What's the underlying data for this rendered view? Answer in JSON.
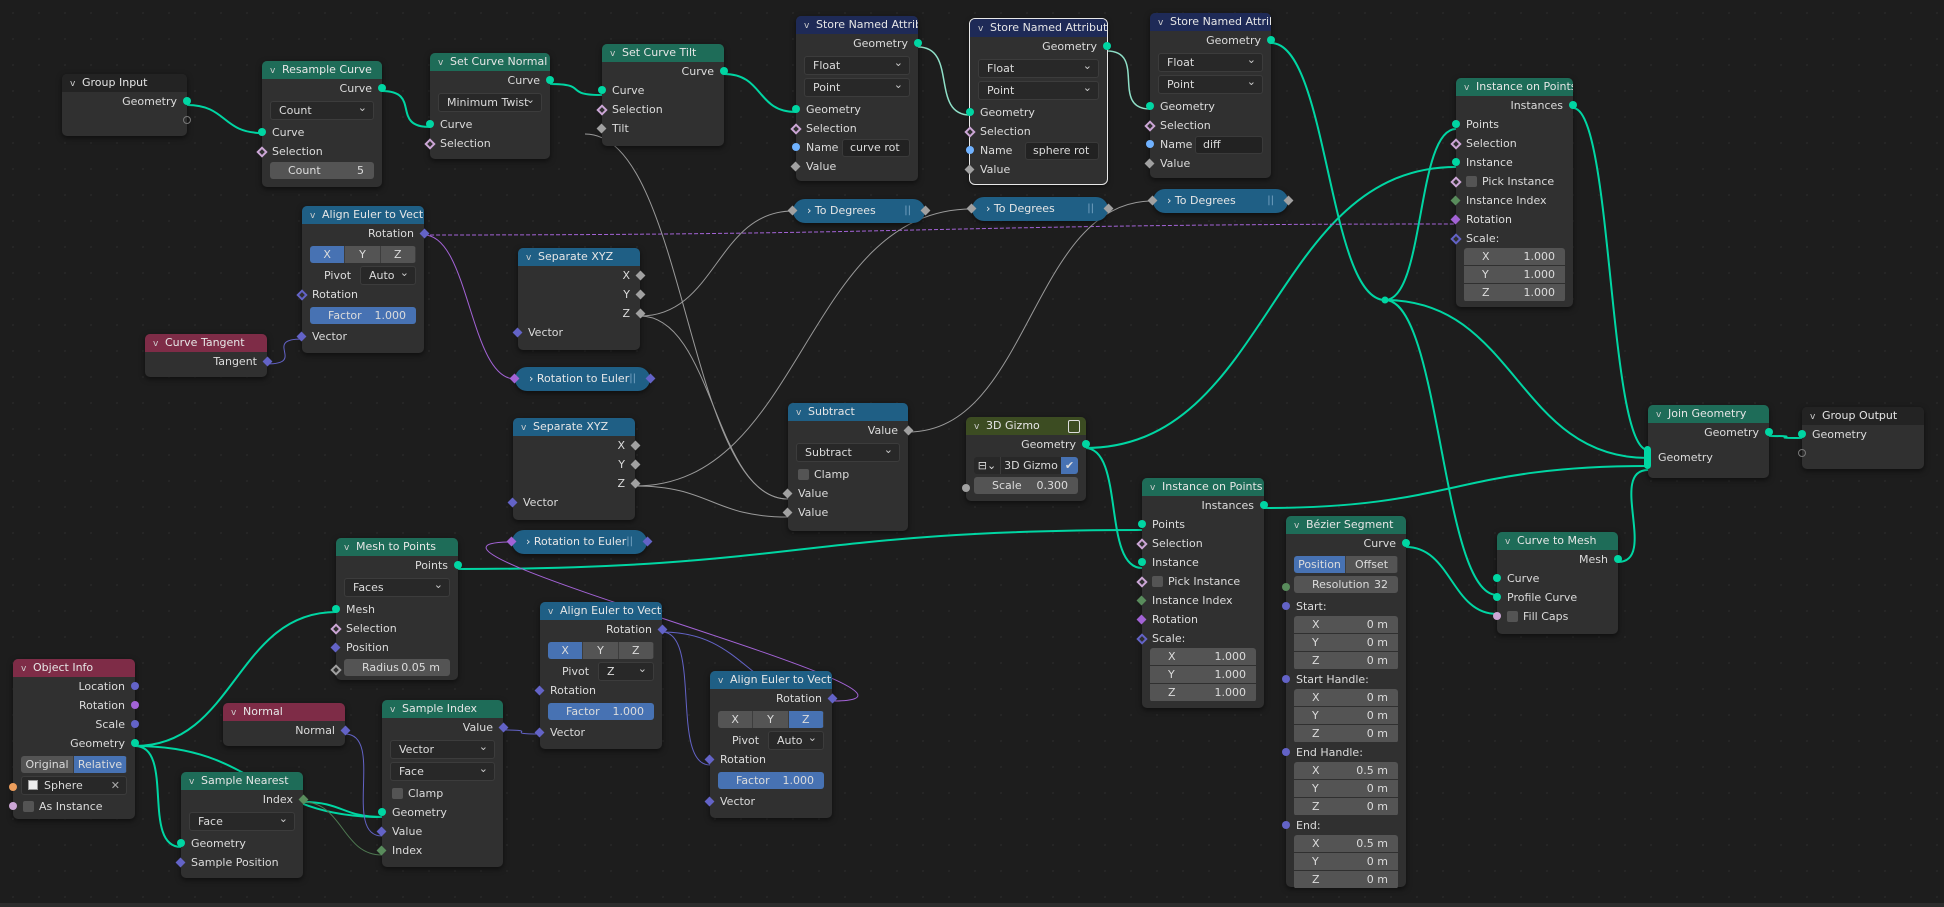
{
  "colors": {
    "background": "#1d1d1d",
    "node_body": "#303030",
    "header_geometry": "#1e6c58",
    "header_field": "#1f5f85",
    "header_input": "#7e2c47",
    "header_attribute": "#1e2a57",
    "header_group": "#232323",
    "header_gizmo": "#3c4c22",
    "socket_geometry": "#00d6a3",
    "socket_vector": "#6363c7",
    "socket_rotation": "#a363d6",
    "socket_float": "#a1a1a1",
    "socket_int": "#598c5c",
    "socket_bool": "#cca6d6",
    "socket_string": "#70b2ff",
    "socket_object": "#ed9e5c",
    "accent_blue": "#4772b3"
  },
  "nodes": {
    "group_input": {
      "title": "Group Input",
      "out_geometry": "Geometry"
    },
    "resample_curve": {
      "title": "Resample Curve",
      "out_curve": "Curve",
      "mode": "Count",
      "in_curve": "Curve",
      "in_selection": "Selection",
      "count_label": "Count",
      "count_value": "5"
    },
    "set_curve_normal": {
      "title": "Set Curve Normal",
      "out_curve": "Curve",
      "mode": "Minimum Twist",
      "in_curve": "Curve",
      "in_selection": "Selection"
    },
    "set_curve_tilt": {
      "title": "Set Curve Tilt",
      "out_curve": "Curve",
      "in_curve": "Curve",
      "in_selection": "Selection",
      "in_tilt": "Tilt"
    },
    "store_attr_1": {
      "title": "Store Named Attrib...",
      "out_geometry": "Geometry",
      "type": "Float",
      "domain": "Point",
      "in_geometry": "Geometry",
      "in_selection": "Selection",
      "name_label": "Name",
      "name_value": "curve rot",
      "in_value": "Value"
    },
    "store_attr_2": {
      "title": "Store Named Attribute",
      "out_geometry": "Geometry",
      "type": "Float",
      "domain": "Point",
      "in_geometry": "Geometry",
      "in_selection": "Selection",
      "name_label": "Name",
      "name_value": "sphere rot",
      "in_value": "Value"
    },
    "store_attr_3": {
      "title": "Store Named Attrib...",
      "out_geometry": "Geometry",
      "type": "Float",
      "domain": "Point",
      "in_geometry": "Geometry",
      "in_selection": "Selection",
      "name_label": "Name",
      "name_value": "diff",
      "in_value": "Value"
    },
    "to_degrees_1": {
      "title": "To Degrees"
    },
    "to_degrees_2": {
      "title": "To Degrees"
    },
    "to_degrees_3": {
      "title": "To Degrees"
    },
    "instance_on_points_1": {
      "title": "Instance on Points",
      "out_instances": "Instances",
      "in_points": "Points",
      "in_selection": "Selection",
      "in_instance": "Instance",
      "pick_instance": "Pick Instance",
      "instance_index": "Instance Index",
      "rotation": "Rotation",
      "scale": "Scale:",
      "scale_x": "1.000",
      "scale_y": "1.000",
      "scale_z": "1.000"
    },
    "align_euler_1": {
      "title": "Align Euler to Vector",
      "out_rotation": "Rotation",
      "axis": [
        "X",
        "Y",
        "Z"
      ],
      "axis_selected": "X",
      "pivot_label": "Pivot",
      "pivot_value": "Auto",
      "in_rotation": "Rotation",
      "factor_label": "Factor",
      "factor_value": "1.000",
      "in_vector": "Vector"
    },
    "curve_tangent": {
      "title": "Curve Tangent",
      "out_tangent": "Tangent"
    },
    "separate_xyz_1": {
      "title": "Separate XYZ",
      "out_x": "X",
      "out_y": "Y",
      "out_z": "Z",
      "in_vector": "Vector"
    },
    "rotation_to_euler_1": {
      "title": "Rotation to Euler"
    },
    "separate_xyz_2": {
      "title": "Separate XYZ",
      "out_x": "X",
      "out_y": "Y",
      "out_z": "Z",
      "in_vector": "Vector"
    },
    "rotation_to_euler_2": {
      "title": "Rotation to Euler"
    },
    "subtract": {
      "title": "Subtract",
      "out_value": "Value",
      "operation": "Subtract",
      "clamp": "Clamp",
      "in_value_1": "Value",
      "in_value_2": "Value"
    },
    "gizmo_3d": {
      "title": "3D Gizmo",
      "out_geometry": "Geometry",
      "gizmo_name": "3D Gizmo",
      "scale_label": "Scale",
      "scale_value": "0.300"
    },
    "instance_on_points_2": {
      "title": "Instance on Points",
      "out_instances": "Instances",
      "in_points": "Points",
      "in_selection": "Selection",
      "in_instance": "Instance",
      "pick_instance": "Pick Instance",
      "instance_index": "Instance Index",
      "rotation": "Rotation",
      "scale": "Scale:",
      "scale_x": "1.000",
      "scale_y": "1.000",
      "scale_z": "1.000"
    },
    "bezier_segment": {
      "title": "Bézier Segment",
      "out_curve": "Curve",
      "mode": [
        "Position",
        "Offset"
      ],
      "mode_selected": "Position",
      "resolution_label": "Resolution",
      "resolution_value": "32",
      "start": "Start:",
      "start_x": "0 m",
      "start_y": "0 m",
      "start_z": "0 m",
      "start_handle": "Start Handle:",
      "start_handle_x": "0 m",
      "start_handle_y": "0 m",
      "start_handle_z": "0 m",
      "end_handle": "End Handle:",
      "end_handle_x": "0.5 m",
      "end_handle_y": "0 m",
      "end_handle_z": "0 m",
      "end": "End:",
      "end_x": "0.5 m",
      "end_y": "0 m",
      "end_z": "0 m"
    },
    "curve_to_mesh": {
      "title": "Curve to Mesh",
      "out_mesh": "Mesh",
      "in_curve": "Curve",
      "in_profile": "Profile Curve",
      "fill_caps": "Fill Caps"
    },
    "join_geometry": {
      "title": "Join Geometry",
      "out_geometry": "Geometry",
      "in_geometry": "Geometry"
    },
    "group_output": {
      "title": "Group Output",
      "in_geometry": "Geometry"
    },
    "mesh_to_points": {
      "title": "Mesh to Points",
      "out_points": "Points",
      "mode": "Faces",
      "in_mesh": "Mesh",
      "in_selection": "Selection",
      "in_position": "Position",
      "radius_label": "Radius",
      "radius_value": "0.05 m"
    },
    "object_info": {
      "title": "Object Info",
      "out_location": "Location",
      "out_rotation": "Rotation",
      "out_scale": "Scale",
      "out_geometry": "Geometry",
      "space": [
        "Original",
        "Relative"
      ],
      "space_selected": "Relative",
      "object_value": "Sphere",
      "as_instance": "As Instance"
    },
    "normal": {
      "title": "Normal",
      "out_normal": "Normal"
    },
    "sample_nearest": {
      "title": "Sample Nearest",
      "out_index": "Index",
      "domain": "Face",
      "in_geometry": "Geometry",
      "in_sample_position": "Sample Position"
    },
    "sample_index": {
      "title": "Sample Index",
      "out_value": "Value",
      "type": "Vector",
      "domain": "Face",
      "clamp": "Clamp",
      "in_geometry": "Geometry",
      "in_value": "Value",
      "in_index": "Index"
    },
    "align_euler_2": {
      "title": "Align Euler to Vector",
      "out_rotation": "Rotation",
      "axis": [
        "X",
        "Y",
        "Z"
      ],
      "axis_selected": "X",
      "pivot_label": "Pivot",
      "pivot_value": "Z",
      "in_rotation": "Rotation",
      "factor_label": "Factor",
      "factor_value": "1.000",
      "in_vector": "Vector"
    },
    "align_euler_3": {
      "title": "Align Euler to Vector",
      "out_rotation": "Rotation",
      "axis": [
        "X",
        "Y",
        "Z"
      ],
      "axis_selected": "Z",
      "pivot_label": "Pivot",
      "pivot_value": "Auto",
      "in_rotation": "Rotation",
      "factor_label": "Factor",
      "factor_value": "1.000",
      "in_vector": "Vector"
    }
  },
  "icons": {
    "collapse": "chevron-down-icon",
    "expand": "chevron-right-icon",
    "gizmo": "gizmo-icon",
    "clear": "close-icon",
    "shield": "shield-icon"
  }
}
